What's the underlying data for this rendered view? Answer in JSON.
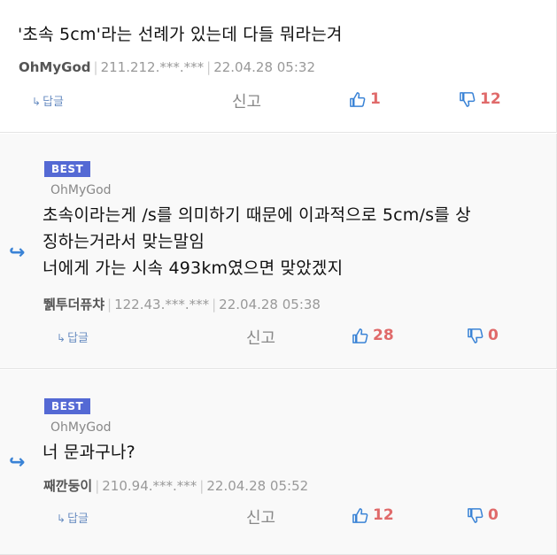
{
  "comments": [
    {
      "body_lines": [
        "'초속 5cm'라는 선례가 있는데 다들 뭐라는겨"
      ],
      "nick": "OhMyGod",
      "ip": "211.212.***.***",
      "date": "22.04.28 05:32",
      "reply_label": "답글",
      "report_label": "신고",
      "up": "1",
      "down": "12"
    },
    {
      "badge": "BEST",
      "reply_to": "OhMyGod",
      "body_lines": [
        "초속이라는게 /s를 의미하기 때문에 이과적으로 5cm/s를 상",
        "징하는거라서 맞는말임",
        "너에게 가는 시속 493km였으면 맞았겠지"
      ],
      "nick": "뛝투더퓨챠",
      "ip": "122.43.***.***",
      "date": "22.04.28 05:38",
      "reply_label": "답글",
      "report_label": "신고",
      "up": "28",
      "down": "0"
    },
    {
      "badge": "BEST",
      "reply_to": "OhMyGod",
      "body_lines": [
        "너 문과구나?"
      ],
      "nick": "째깐둥이",
      "ip": "210.94.***.***",
      "date": "22.04.28 05:52",
      "reply_label": "답글",
      "report_label": "신고",
      "up": "12",
      "down": "0"
    }
  ],
  "colors": {
    "accent_blue": "#3a83d6",
    "badge_bg": "#5469d4",
    "vote_count": "#e06a6a"
  },
  "icons": {
    "reply_arrow": "reply-arrow-icon",
    "thumbs_up": "thumbs-up-icon",
    "thumbs_down": "thumbs-down-icon"
  }
}
